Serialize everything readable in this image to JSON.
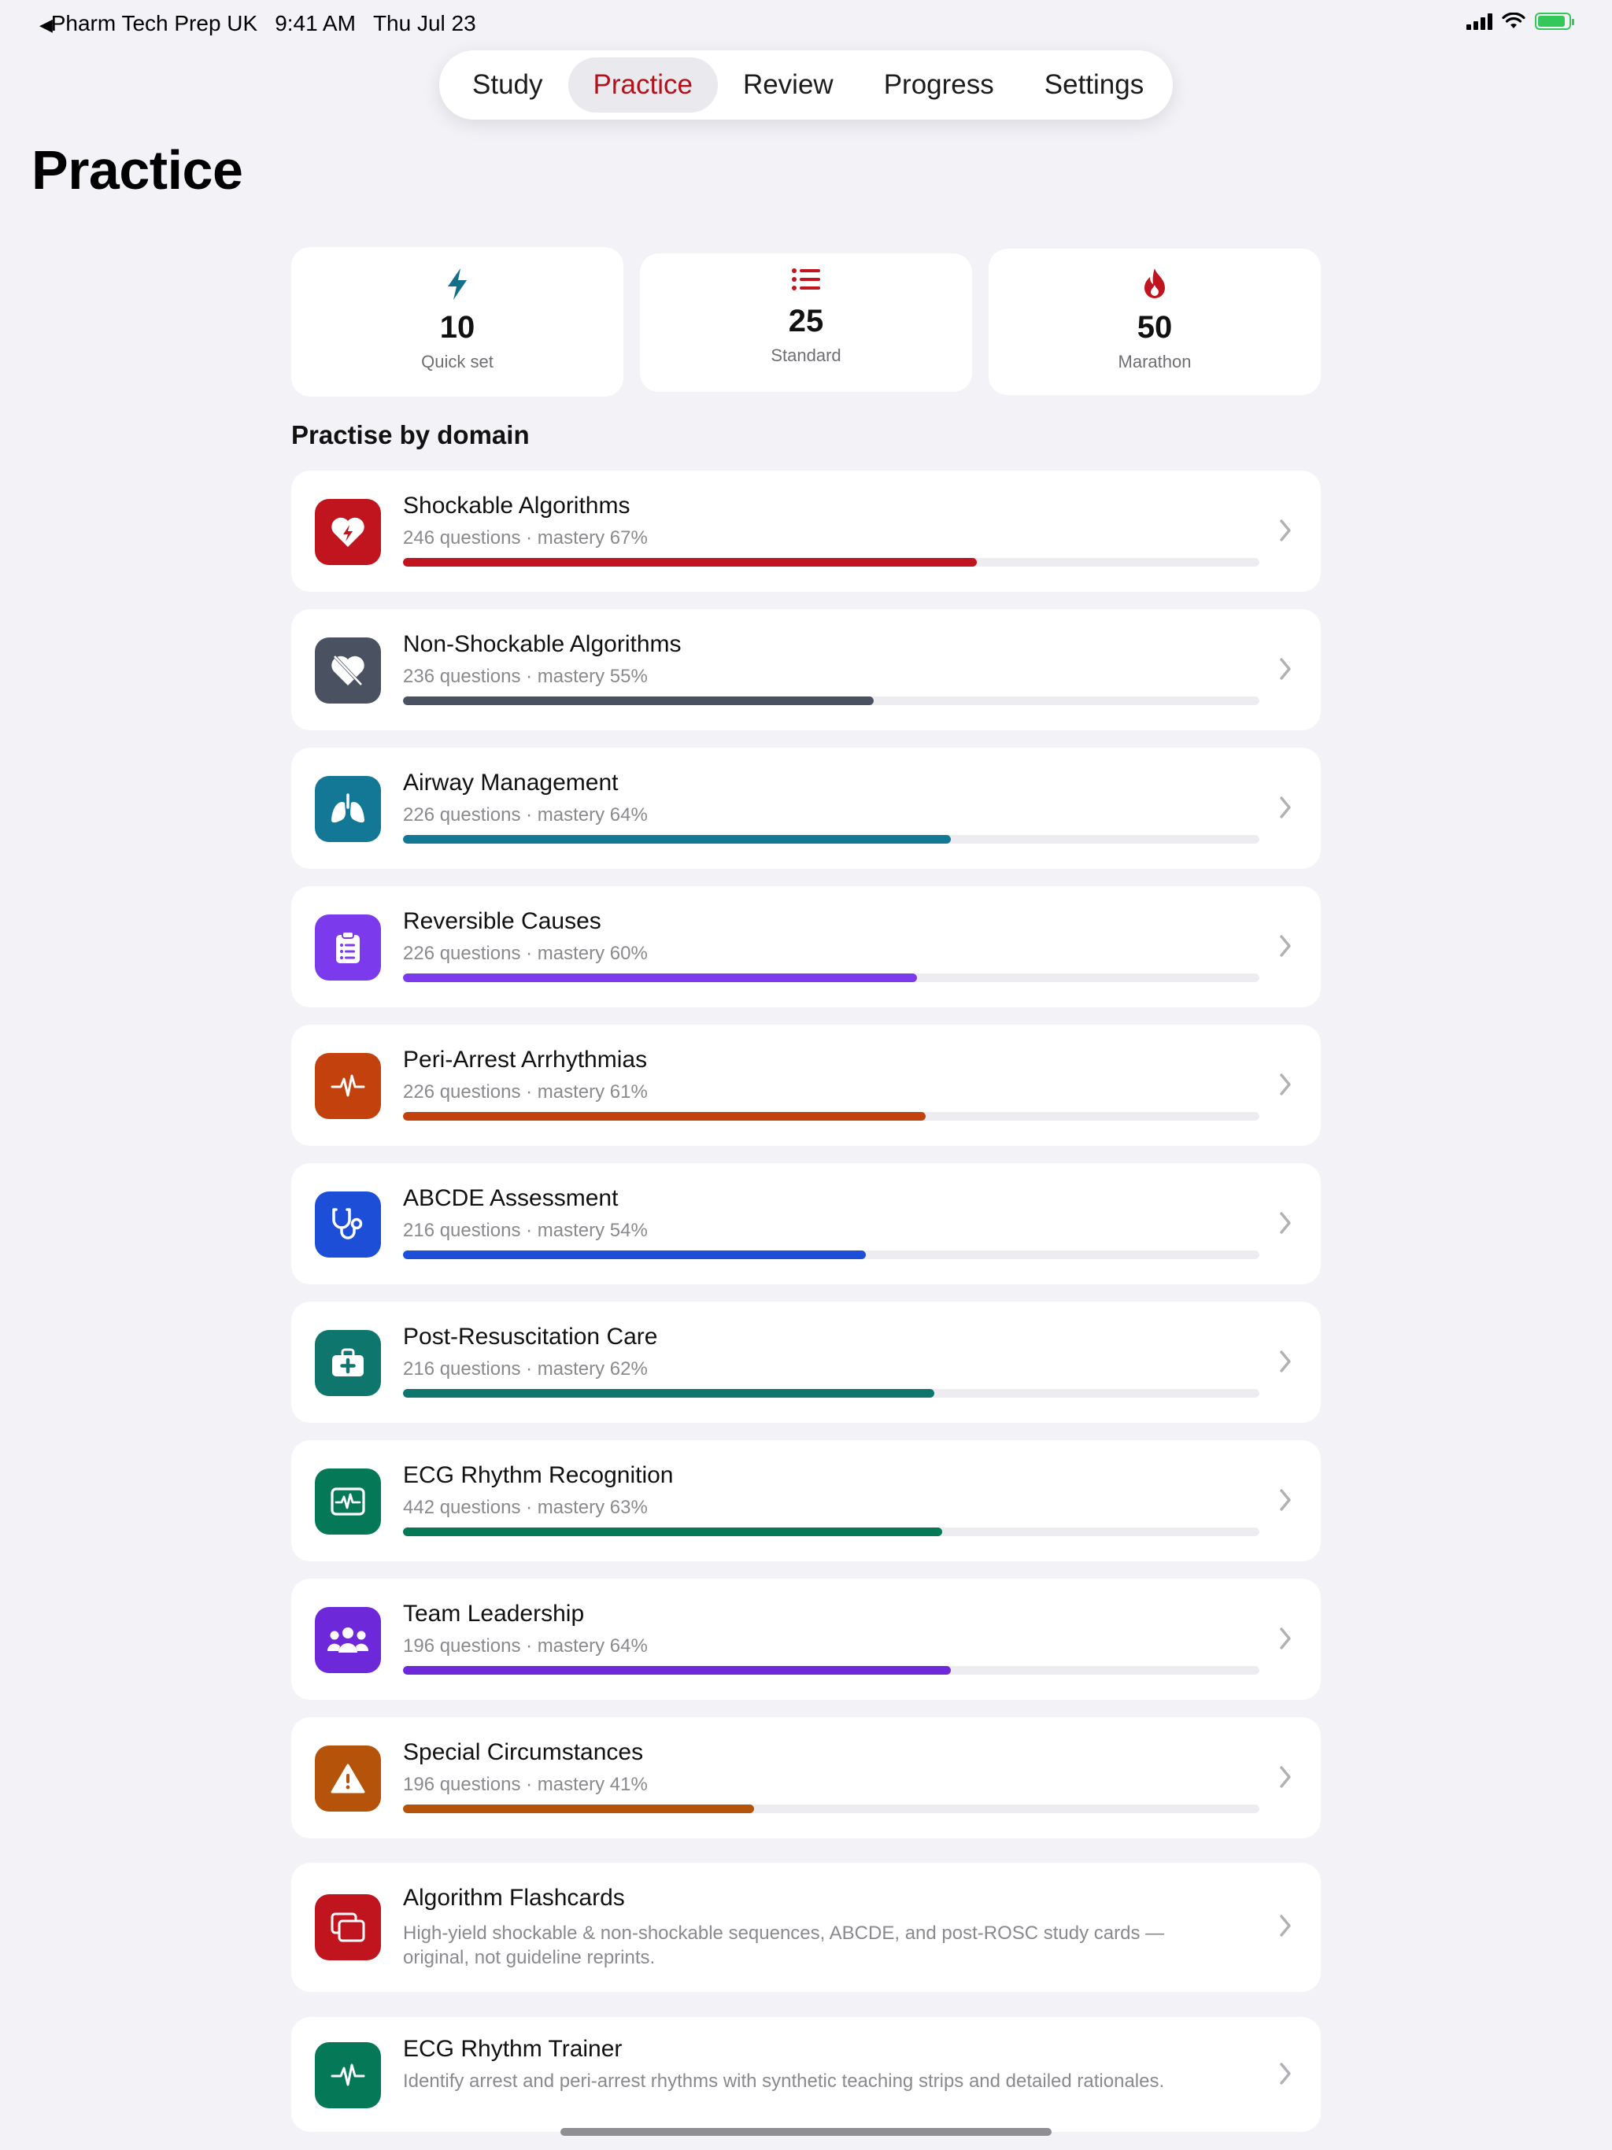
{
  "status_bar": {
    "back_app": "Pharm Tech Prep UK",
    "time": "9:41 AM",
    "date": "Thu Jul 23"
  },
  "tabs": [
    {
      "label": "Study"
    },
    {
      "label": "Practice"
    },
    {
      "label": "Review"
    },
    {
      "label": "Progress"
    },
    {
      "label": "Settings"
    }
  ],
  "active_tab": "Practice",
  "page_title": "Practice",
  "sets": [
    {
      "count": "10",
      "label": "Quick set",
      "icon": "bolt-icon",
      "color": "#136f8a"
    },
    {
      "count": "25",
      "label": "Standard",
      "icon": "list-icon",
      "color": "#c0141e"
    },
    {
      "count": "50",
      "label": "Marathon",
      "icon": "flame-icon",
      "color": "#c0141e"
    }
  ],
  "section_title": "Practise by domain",
  "domains": [
    {
      "title": "Shockable Algorithms",
      "subtitle": "246 questions · mastery 67%",
      "mastery": 0.67,
      "color": "#c0141e",
      "icon": "heart-bolt-icon"
    },
    {
      "title": "Non-Shockable Algorithms",
      "subtitle": "236 questions · mastery 55%",
      "mastery": 0.55,
      "color": "#4a5160",
      "icon": "heart-slash-icon"
    },
    {
      "title": "Airway Management",
      "subtitle": "226 questions · mastery 64%",
      "mastery": 0.64,
      "color": "#137896",
      "icon": "lungs-icon"
    },
    {
      "title": "Reversible Causes",
      "subtitle": "226 questions · mastery 60%",
      "mastery": 0.6,
      "color": "#7c3aed",
      "icon": "clipboard-icon"
    },
    {
      "title": "Peri-Arrest Arrhythmias",
      "subtitle": "226 questions · mastery 61%",
      "mastery": 0.61,
      "color": "#c2410c",
      "icon": "pulse-icon"
    },
    {
      "title": "ABCDE Assessment",
      "subtitle": "216 questions · mastery 54%",
      "mastery": 0.54,
      "color": "#1d4ed8",
      "icon": "stethoscope-icon"
    },
    {
      "title": "Post-Resuscitation Care",
      "subtitle": "216 questions · mastery 62%",
      "mastery": 0.62,
      "color": "#0f766e",
      "icon": "medkit-icon"
    },
    {
      "title": "ECG Rhythm Recognition",
      "subtitle": "442 questions · mastery 63%",
      "mastery": 0.63,
      "color": "#047857",
      "icon": "monitor-waveform-icon"
    },
    {
      "title": "Team Leadership",
      "subtitle": "196 questions · mastery 64%",
      "mastery": 0.64,
      "color": "#6d28d9",
      "icon": "people-icon"
    },
    {
      "title": "Special Circumstances",
      "subtitle": "196 questions · mastery 41%",
      "mastery": 0.41,
      "color": "#b45309",
      "icon": "warning-icon"
    }
  ],
  "extras": [
    {
      "title": "Algorithm Flashcards",
      "subtitle": "High-yield shockable & non-shockable sequences, ABCDE, and post-ROSC study cards — original, not guideline reprints.",
      "color": "#c0141e",
      "icon": "cards-icon"
    },
    {
      "title": "ECG Rhythm Trainer",
      "subtitle": "Identify arrest and peri-arrest rhythms with synthetic teaching strips and detailed rationales.",
      "color": "#047857",
      "icon": "waveform-icon"
    }
  ]
}
